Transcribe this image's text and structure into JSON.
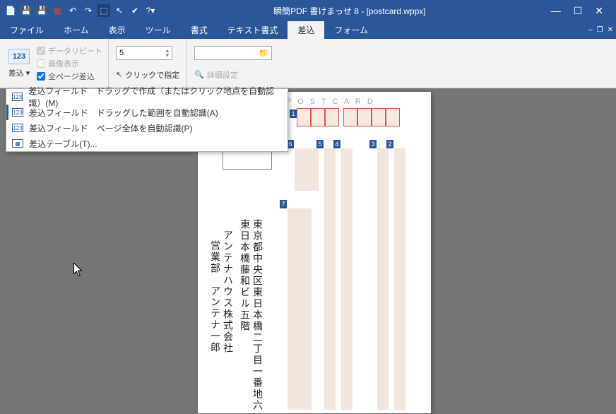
{
  "title": "瞬簡PDF 書けまっせ 8 - [postcard.wppx]",
  "menus": {
    "file": "ファイル",
    "home": "ホーム",
    "view": "表示",
    "tool": "ツール",
    "format": "書式",
    "text_format": "テキスト書式",
    "merge": "差込",
    "form": "フォーム"
  },
  "ribbon": {
    "big_btn_icon": "123",
    "big_btn_label": "差込",
    "chk_data_repeat": "データリピート",
    "chk_image_show": "画像表示",
    "chk_all_page": "全ページ差込",
    "num_value": "5",
    "click_spec": "クリックで指定",
    "detail": "詳細設定"
  },
  "dropdown": [
    "差込フィールド　ドラッグで作成（またはクリック地点を自動認識）(M)",
    "差込フィールド　ドラッグした範囲を自動認識(A)",
    "差込フィールド　ページ全体を自動認識(P)",
    "差込テーブル(T)..."
  ],
  "page": {
    "label": "P O S T  C A R D",
    "field_tags": [
      "1",
      "2",
      "3",
      "4",
      "5",
      "6",
      "7"
    ],
    "vtext_lines": [
      "東京都中央区東日本橋二丁目一番地六",
      "東日本橋藤和ビル五階",
      "アンテナハウス株式会社",
      "営業部　アンテナ一郎"
    ]
  }
}
